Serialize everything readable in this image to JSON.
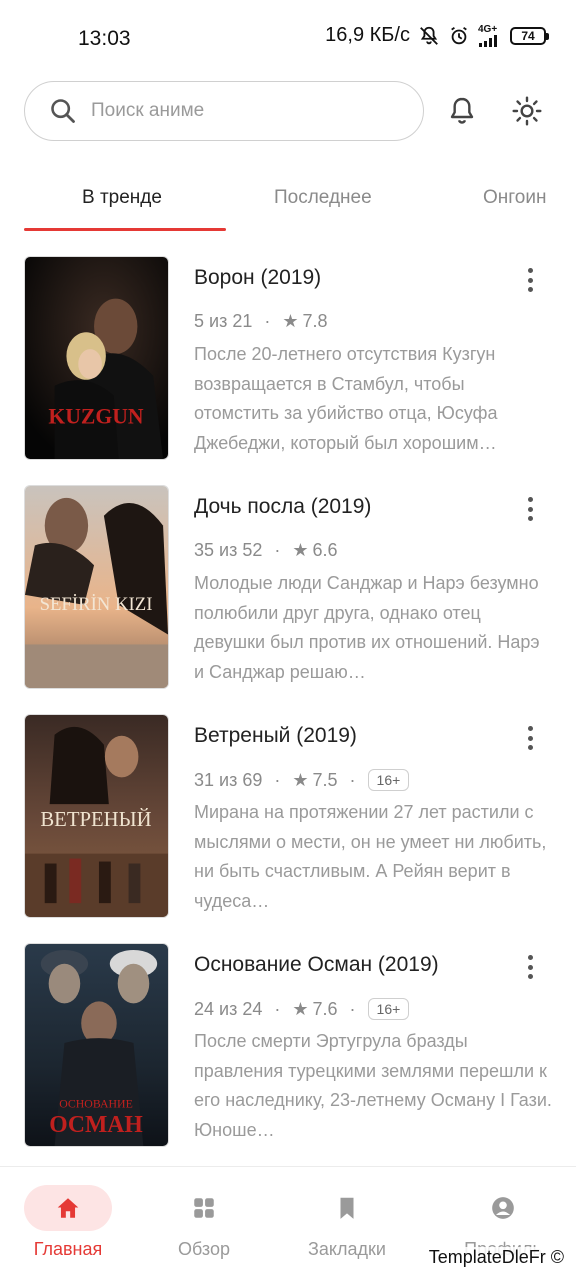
{
  "status_bar": {
    "time": "13:03",
    "speed": "16,9 КБ/с",
    "network_top": "4G+",
    "battery": "74"
  },
  "search": {
    "placeholder": "Поиск аниме"
  },
  "tabs": [
    {
      "label": "В тренде",
      "active": true
    },
    {
      "label": "Последнее",
      "active": false
    },
    {
      "label": "Онгоин",
      "active": false
    }
  ],
  "items": [
    {
      "title": "Ворон (2019)",
      "episodes": "5 из 21",
      "rating": "7.8",
      "age": "",
      "description": "После 20-летнего отсутствия Кузгун возвращается в Стамбул, чтобы отомстить за убийство отца, Юсуфа Джебеджи, который был хорошим…",
      "poster_text": "KUZGUN"
    },
    {
      "title": "Дочь посла (2019)",
      "episodes": "35 из 52",
      "rating": "6.6",
      "age": "",
      "description": "Молодые люди Санджар и Нарэ безумно полюбили друг друга, однако отец девушки был против их отношений. Нарэ и Санджар решаю…",
      "poster_text": "SEFİRİN KIZI"
    },
    {
      "title": "Ветреный (2019)",
      "episodes": "31 из 69",
      "rating": "7.5",
      "age": "16+",
      "description": "Мирана на протяжении 27 лет растили с мыслями о мести, он не умеет ни любить, ни быть счастливым. А Рейян верит в чудеса…",
      "poster_text": "ВЕТРЕНЫЙ"
    },
    {
      "title": "Основание Осман (2019)",
      "episodes": "24 из 24",
      "rating": "7.6",
      "age": "16+",
      "description": "После смерти Эртугрула бразды правления турецкими землями перешли к его наследнику, 23-летнему Осману I Гази. Юноше…",
      "poster_text_1": "ОСНОВАНИЕ",
      "poster_text_2": "ОСМАН"
    }
  ],
  "separator": "·",
  "star_glyph": "★",
  "bottom_nav": [
    {
      "label": "Главная",
      "icon": "home-icon",
      "active": true
    },
    {
      "label": "Обзор",
      "icon": "grid-icon",
      "active": false
    },
    {
      "label": "Закладки",
      "icon": "bookmark-icon",
      "active": false
    },
    {
      "label": "Профиль",
      "icon": "profile-icon",
      "active": false
    }
  ],
  "watermark": "TemplateDleFr ©",
  "colors": {
    "accent": "#e53935",
    "accent_bg": "#fde4e4",
    "muted": "#9a9a9a"
  }
}
